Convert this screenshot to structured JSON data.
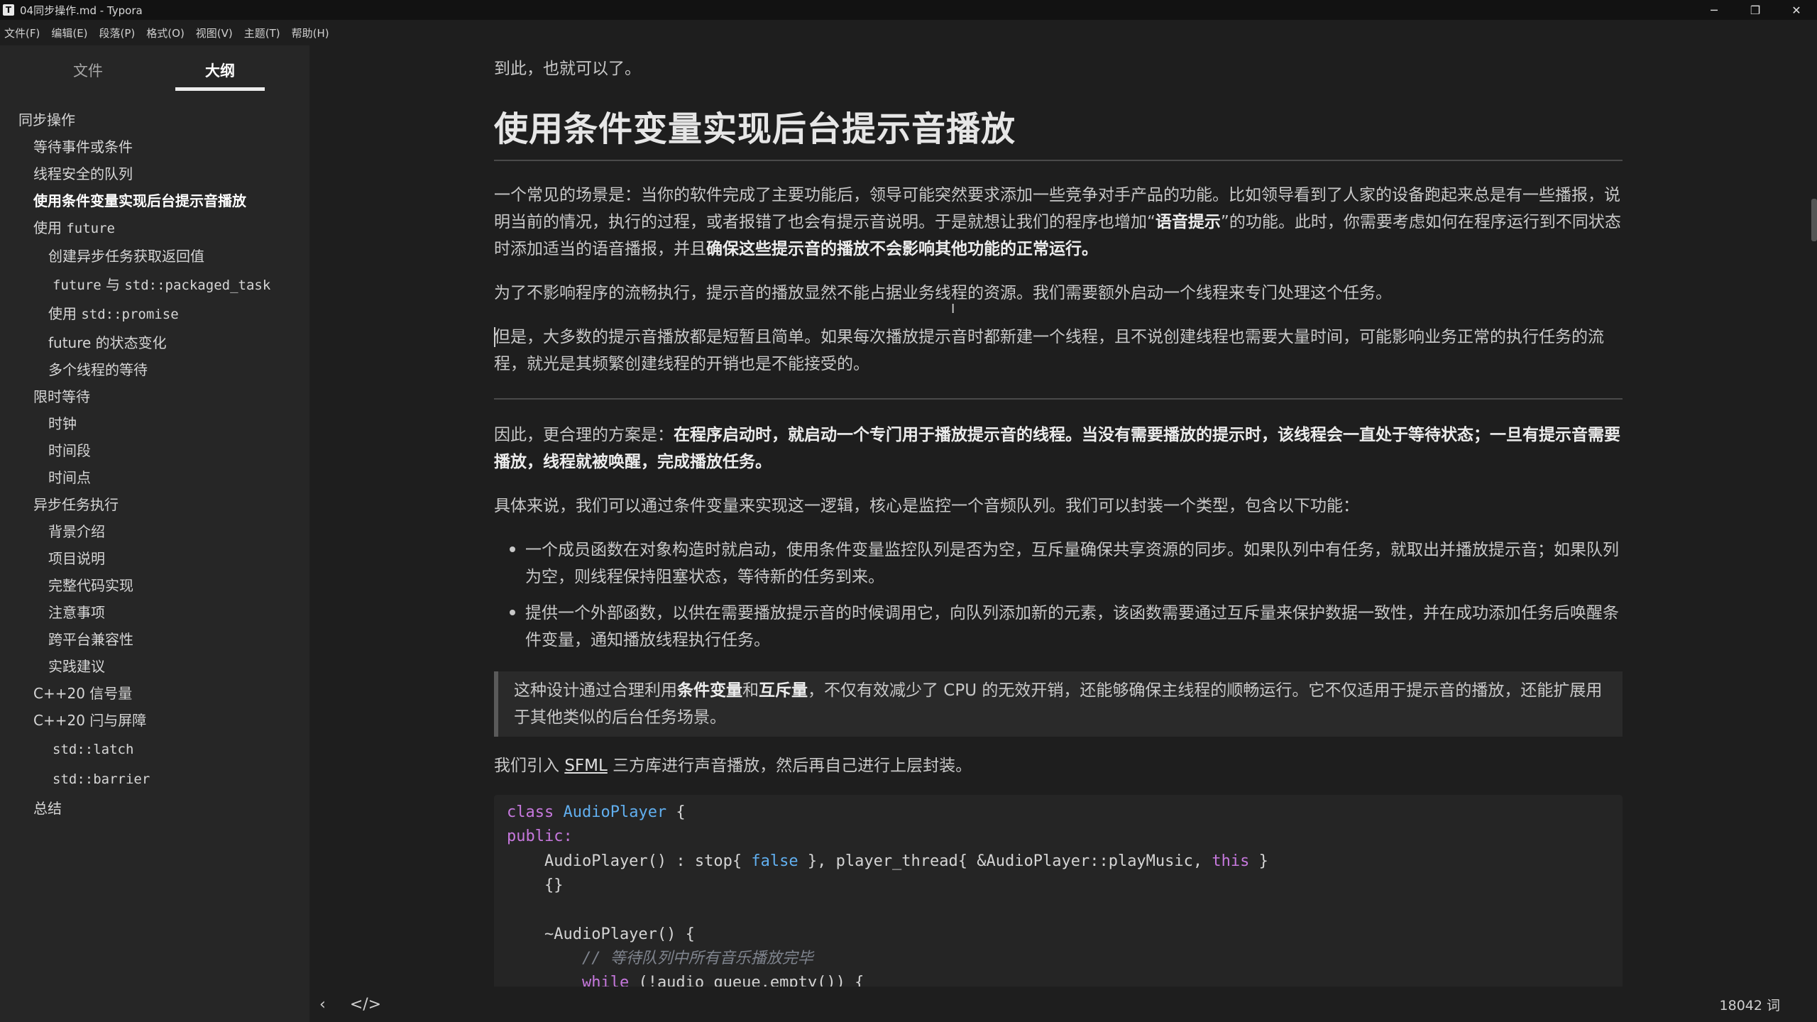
{
  "window": {
    "title": "04同步操作.md - Typora",
    "app_icon": "T",
    "controls": {
      "minimize": "─",
      "restore": "❐",
      "close": "✕"
    }
  },
  "menubar": [
    "文件(F)",
    "编辑(E)",
    "段落(P)",
    "格式(O)",
    "视图(V)",
    "主题(T)",
    "帮助(H)"
  ],
  "sidebar": {
    "tabs": {
      "files": "文件",
      "outline": "大纲"
    },
    "outline": [
      {
        "label": "同步操作"
      },
      {
        "label": "等待事件或条件"
      },
      {
        "label": "线程安全的队列"
      },
      {
        "label": "使用条件变量实现后台提示音播放"
      },
      {
        "label": "使用",
        "code": "future"
      },
      {
        "label": "创建异步任务获取返回值"
      },
      {
        "code1": "future",
        "label": "与",
        "code2": "std::packaged_task"
      },
      {
        "label": "使用",
        "code": "std::promise"
      },
      {
        "label": "future 的状态变化"
      },
      {
        "label": "多个线程的等待"
      },
      {
        "label": "限时等待"
      },
      {
        "label": "时钟"
      },
      {
        "label": "时间段"
      },
      {
        "label": "时间点"
      },
      {
        "label": "异步任务执行"
      },
      {
        "label": "背景介绍"
      },
      {
        "label": "项目说明"
      },
      {
        "label": "完整代码实现"
      },
      {
        "label": "注意事项"
      },
      {
        "label": "跨平台兼容性"
      },
      {
        "label": "实践建议"
      },
      {
        "label": "C++20 信号量"
      },
      {
        "label": "C++20 闩与屏障"
      },
      {
        "code": "std::latch"
      },
      {
        "code": "std::barrier"
      },
      {
        "label": "总结"
      }
    ]
  },
  "content": {
    "p_top": "到此，也就可以了。",
    "heading": "使用条件变量实现后台提示音播放",
    "p1_a": "一个常见的场景是：当你的软件完成了主要功能后，领导可能突然要求添加一些竞争对手产品的功能。比如领导看到了人家的设备跑起来总是有一些播报，说明当前的情况，执行的过程，或者报错了也会有提示音说明。于是就想让我们的程序也增加“",
    "p1_b": "语音提示",
    "p1_c": "”的功能。此时，你需要考虑如何在程序运行到不同状态时添加适当的语音播报，并且",
    "p1_d": "确保这些提示音的播放不会影响其他功能的正常运行。",
    "p2": "为了不影响程序的流畅执行，提示音的播放显然不能占据业务线程的资源。我们需要额外启动一个线程来专门处理这个任务。",
    "p3": "但是，大多数的提示音播放都是短暂且简单。如果每次播放提示音时都新建一个线程，且不说创建线程也需要大量时间，可能影响业务正常的执行任务的流程，就光是其频繁创建线程的开销也是不能接受的。",
    "p4_a": "因此，更合理的方案是：",
    "p4_b": "在程序启动时，就启动一个专门用于播放提示音的线程。当没有需要播放的提示时，该线程会一直处于等待状态；一旦有提示音需要播放，线程就被唤醒，完成播放任务。",
    "p5": "具体来说，我们可以通过条件变量来实现这一逻辑，核心是监控一个音频队列。我们可以封装一个类型，包含以下功能：",
    "li1": "一个成员函数在对象构造时就启动，使用条件变量监控队列是否为空，互斥量确保共享资源的同步。如果队列中有任务，就取出并播放提示音；如果队列为空，则线程保持阻塞状态，等待新的任务到来。",
    "li2": "提供一个外部函数，以供在需要播放提示音的时候调用它，向队列添加新的元素，该函数需要通过互斥量来保护数据一致性，并在成功添加任务后唤醒条件变量，通知播放线程执行任务。",
    "q_a": "这种设计通过合理利用",
    "q_b": "条件变量",
    "q_c": "和",
    "q_d": "互斥量",
    "q_e": "，不仅有效减少了 CPU 的无效开销，还能够确保主线程的顺畅运行。它不仅适用于提示音的播放，还能扩展用于其他类似的后台任务场景。",
    "p6_a": "我们引入 ",
    "p6_link": "SFML",
    "p6_b": " 三方库进行声音播放，然后再自己进行上层封装。",
    "code": {
      "l1_kw": "class",
      "l1_ty": "AudioPlayer",
      "l1_rest": " {",
      "l2": "public:",
      "l3_a": "    AudioPlayer() : stop{ ",
      "l3_false": "false",
      "l3_b": " }, player_thread{ &AudioPlayer::playMusic, ",
      "l3_this": "this",
      "l3_c": " }",
      "l4": "    {}",
      "l5": "    ~AudioPlayer() {",
      "l6": "        // 等待队列中所有音乐播放完毕",
      "l7_kw": "while",
      "l7_rest": " (!audio_queue.empty()) {"
    }
  },
  "statusbar": {
    "back_icon": "‹",
    "source_icon": "</>",
    "word_count": "18042 词"
  }
}
